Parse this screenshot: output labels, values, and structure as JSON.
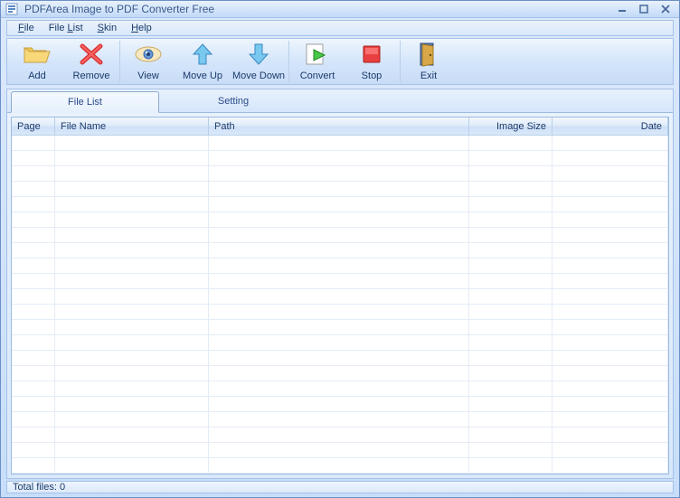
{
  "window": {
    "title": "PDFArea Image to PDF Converter Free"
  },
  "menu": {
    "file": "File",
    "filelist": "File List",
    "skin": "Skin",
    "help": "Help"
  },
  "toolbar": {
    "add": "Add",
    "remove": "Remove",
    "view": "View",
    "moveup": "Move Up",
    "movedown": "Move Down",
    "convert": "Convert",
    "stop": "Stop",
    "exit": "Exit"
  },
  "tabs": {
    "filelist": "File List",
    "setting": "Setting"
  },
  "columns": {
    "page": "Page",
    "filename": "File Name",
    "path": "Path",
    "imagesize": "Image Size",
    "date": "Date"
  },
  "status": {
    "total": "Total files: 0"
  }
}
